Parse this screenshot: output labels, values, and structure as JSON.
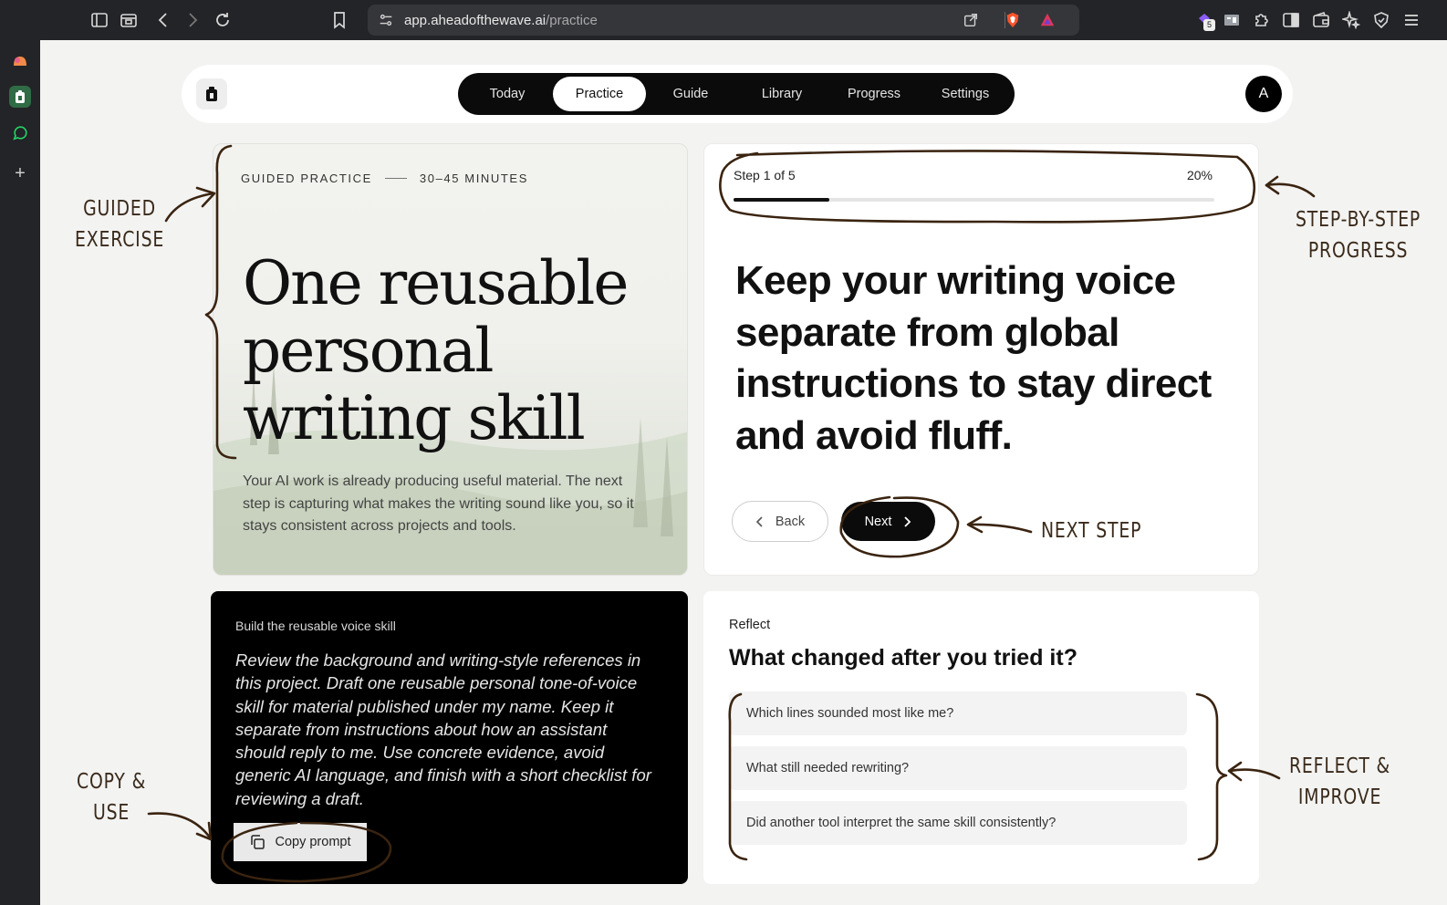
{
  "browser": {
    "url_host": "app.aheadofthewave.ai",
    "url_path": "/practice",
    "extension_badge": "5"
  },
  "nav": {
    "tabs": [
      {
        "label": "Today"
      },
      {
        "label": "Practice"
      },
      {
        "label": "Guide"
      },
      {
        "label": "Library"
      },
      {
        "label": "Progress"
      },
      {
        "label": "Settings"
      }
    ],
    "active_tab": "Practice",
    "avatar_initial": "A"
  },
  "hero": {
    "kicker": "GUIDED PRACTICE",
    "duration": "30–45 MINUTES",
    "title": "One reusable personal writing skill",
    "description": "Your AI work is already producing useful material. The next step is capturing what makes the writing sound like you, so it stays consistent across projects and tools."
  },
  "step": {
    "label": "Step 1 of 5",
    "percent_label": "20%",
    "progress": 0.2,
    "text": "Keep your writing voice separate from global instructions to stay direct and avoid fluff.",
    "back_label": "Back",
    "next_label": "Next"
  },
  "prompt": {
    "title": "Build the reusable voice skill",
    "body": "Review the background and writing-style references in this project. Draft one reusable personal tone-of-voice skill for material published under my name. Keep it separate from instructions about how an assistant should reply to me. Use concrete evidence, avoid generic AI language, and finish with a short checklist for reviewing a draft.",
    "copy_label": "Copy prompt"
  },
  "reflect": {
    "kicker": "Reflect",
    "title": "What changed after you tried it?",
    "questions": [
      "Which lines sounded most like me?",
      "What still needed rewriting?",
      "Did another tool interpret the same skill consistently?"
    ]
  },
  "annotations": {
    "guided_1": "GUIDED",
    "guided_2": "EXERCISE",
    "progress_1": "STEP-BY-STEP",
    "progress_2": "PROGRESS",
    "next": "NEXT STEP",
    "copy_1": "COPY &",
    "copy_2": "USE",
    "reflect_1": "REFLECT &",
    "reflect_2": "IMPROVE"
  },
  "colors": {
    "annotation_ink": "#3a2a1a",
    "tab_bar": "#0b0b0b",
    "page_bg": "#f3f3f2"
  }
}
